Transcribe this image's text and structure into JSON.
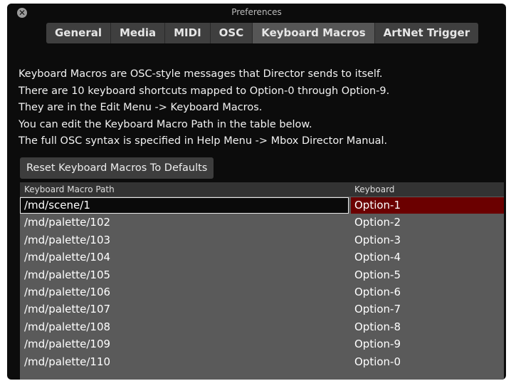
{
  "window": {
    "title": "Preferences",
    "close_symbol": "✕"
  },
  "tabs": [
    {
      "label": "General",
      "active": false
    },
    {
      "label": "Media",
      "active": false
    },
    {
      "label": "MIDI",
      "active": false
    },
    {
      "label": "OSC",
      "active": false
    },
    {
      "label": "Keyboard Macros",
      "active": true
    },
    {
      "label": "ArtNet Trigger",
      "active": false
    }
  ],
  "description": [
    "Keyboard Macros are OSC-style messages that Director sends to itself.",
    "There are 10 keyboard shortcuts mapped to Option-0 through Option-9.",
    "They are in the Edit Menu -> Keyboard Macros.",
    "You can edit the Keyboard Macro Path in the table below.",
    "The full OSC syntax is specified in Help Menu -> Mbox Director Manual."
  ],
  "reset_button": {
    "label": "Reset Keyboard Macros To Defaults"
  },
  "table": {
    "headers": {
      "path": "Keyboard Macro Path",
      "key": "Keyboard"
    },
    "selected_index": 0,
    "rows": [
      {
        "path": "/md/scene/1",
        "key": "Option-1"
      },
      {
        "path": "/md/palette/102",
        "key": "Option-2"
      },
      {
        "path": "/md/palette/103",
        "key": "Option-3"
      },
      {
        "path": "/md/palette/104",
        "key": "Option-4"
      },
      {
        "path": "/md/palette/105",
        "key": "Option-5"
      },
      {
        "path": "/md/palette/106",
        "key": "Option-6"
      },
      {
        "path": "/md/palette/107",
        "key": "Option-7"
      },
      {
        "path": "/md/palette/108",
        "key": "Option-8"
      },
      {
        "path": "/md/palette/109",
        "key": "Option-9"
      },
      {
        "path": "/md/palette/110",
        "key": "Option-0"
      }
    ]
  },
  "colors": {
    "window_bg": "#0c0c0c",
    "tab_bg": "#3f3f3f",
    "table_bg": "#5a5a5a",
    "selected_key_bg": "#6b0000"
  }
}
